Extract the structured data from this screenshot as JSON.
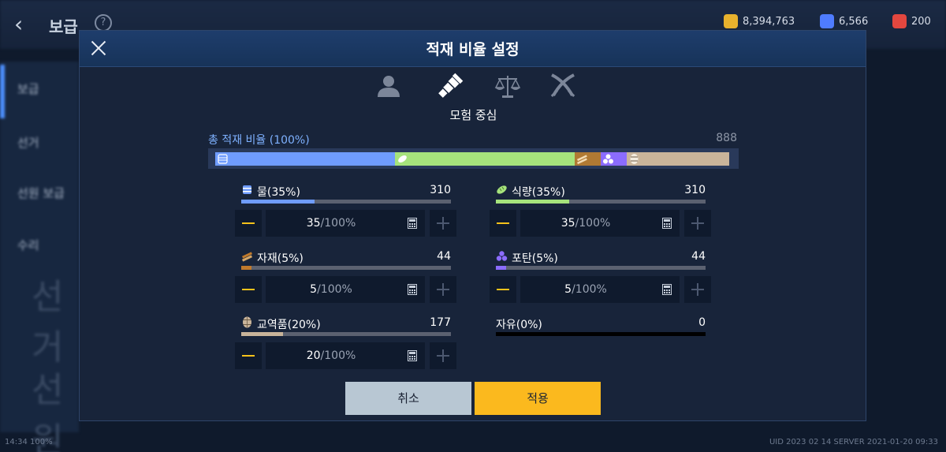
{
  "background": {
    "title": "보급",
    "help": "?",
    "currencies": [
      {
        "value": "8,394,763",
        "color": "#e8b22d",
        "icon": "gold-coin-icon"
      },
      {
        "value": "6,566",
        "color": "#4f7cff",
        "icon": "blue-gem-icon"
      },
      {
        "value": "200",
        "color": "#e3473f",
        "icon": "red-gem-icon"
      }
    ],
    "sidebar": [
      "보급",
      "선거",
      "선원 보급",
      "수리"
    ],
    "sidebar_large": [
      "선거",
      "선원"
    ],
    "status_left": "14:34  100%",
    "status_right": "UID 2023 02 14 SERVER 2021-01-20 09:33"
  },
  "modal": {
    "title": "적재 비율 설정",
    "mode_icons": [
      "person-icon",
      "spyglass-icon",
      "balance-scale-icon",
      "crossed-swords-icon"
    ],
    "selected_mode": 1,
    "mode_label": "모험 중심",
    "total_label": "총 적재 비율 (100%)",
    "total_value": "888",
    "segments": [
      {
        "name": "물",
        "percent": 35,
        "color": "#6f9cff",
        "icon": "water-barrel-icon"
      },
      {
        "name": "식량",
        "percent": 35,
        "color": "#a6e37c",
        "icon": "bread-icon"
      },
      {
        "name": "자재",
        "percent": 5,
        "color": "#b07933",
        "icon": "lumber-icon"
      },
      {
        "name": "포탄",
        "percent": 5,
        "color": "#8b6cff",
        "icon": "cannonball-icon"
      },
      {
        "name": "교역품",
        "percent": 20,
        "color": "#c9b49a",
        "icon": "cask-icon"
      }
    ],
    "resources": [
      {
        "key": "water",
        "label": "물(35%)",
        "count": "310",
        "value": "35",
        "max": "/100%",
        "fill": 0.35,
        "color": "#6f9cff",
        "icon": "water-barrel-icon"
      },
      {
        "key": "food",
        "label": "식량(35%)",
        "count": "310",
        "value": "35",
        "max": "/100%",
        "fill": 0.35,
        "color": "#a6e37c",
        "icon": "bread-icon"
      },
      {
        "key": "material",
        "label": "자재(5%)",
        "count": "44",
        "value": "5",
        "max": "/100%",
        "fill": 0.05,
        "color": "#c07a2c",
        "icon": "lumber-icon"
      },
      {
        "key": "cannonball",
        "label": "포탄(5%)",
        "count": "44",
        "value": "5",
        "max": "/100%",
        "fill": 0.05,
        "color": "#8b6cff",
        "icon": "cannonball-icon"
      },
      {
        "key": "trade",
        "label": "교역품(20%)",
        "count": "177",
        "value": "20",
        "max": "/100%",
        "fill": 0.2,
        "color": "#c9b49a",
        "icon": "cask-icon"
      }
    ],
    "free": {
      "label": "자유(0%)",
      "count": "0"
    },
    "cancel_label": "취소",
    "apply_label": "적용"
  }
}
